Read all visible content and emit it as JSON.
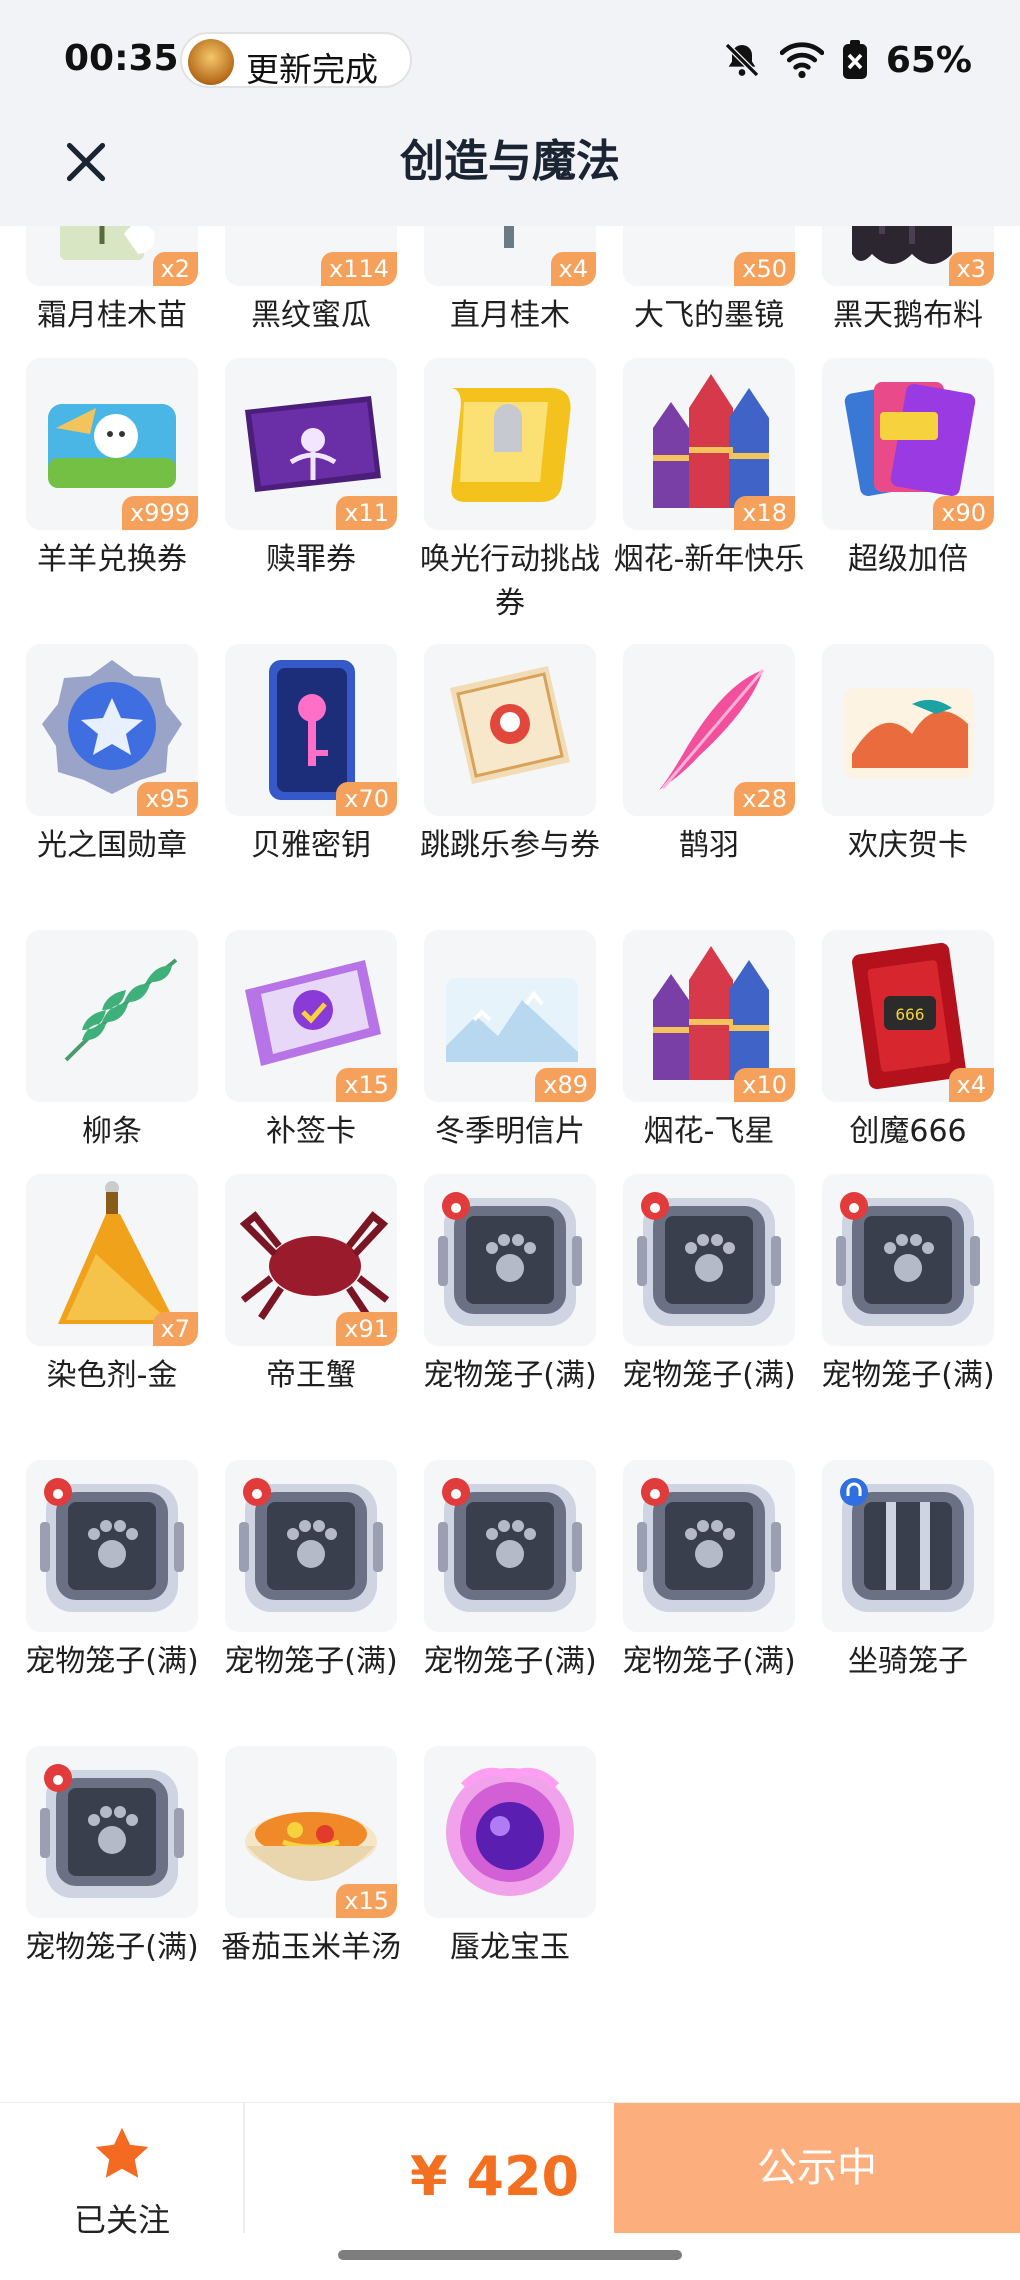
{
  "status": {
    "time": "00:35",
    "notification": "更新完成",
    "battery": "65%"
  },
  "header": {
    "title": "创造与魔法"
  },
  "items": [
    {
      "name": "霜月桂木苗",
      "count": "x2",
      "icon": "plant-pot-icon"
    },
    {
      "name": "黑纹蜜瓜",
      "count": "x114",
      "icon": "melon-icon"
    },
    {
      "name": "直月桂木",
      "count": "x4",
      "icon": "yellow-tree-icon"
    },
    {
      "name": "大飞的墨镜",
      "count": "x50",
      "icon": "sunglasses-icon"
    },
    {
      "name": "黑天鹅布料",
      "count": "x3",
      "icon": "black-cloth-icon"
    },
    {
      "name": "羊羊兑换券",
      "count": "x999",
      "icon": "sheep-ticket-icon"
    },
    {
      "name": "赎罪券",
      "count": "x11",
      "icon": "purple-ticket-icon"
    },
    {
      "name": "唤光行动挑战券",
      "count": "",
      "icon": "yellow-scroll-icon"
    },
    {
      "name": "烟花-新年快乐",
      "count": "x18",
      "icon": "firework-icon"
    },
    {
      "name": "超级加倍",
      "count": "x90",
      "icon": "cards-icon"
    },
    {
      "name": "光之国勋章",
      "count": "x95",
      "icon": "star-medal-icon"
    },
    {
      "name": "贝雅密钥",
      "count": "x70",
      "icon": "key-card-icon"
    },
    {
      "name": "跳跳乐参与券",
      "count": "",
      "icon": "ticket-icon"
    },
    {
      "name": "鹊羽",
      "count": "x28",
      "icon": "pink-feather-icon"
    },
    {
      "name": "欢庆贺卡",
      "count": "",
      "icon": "greeting-card-icon"
    },
    {
      "name": "柳条",
      "count": "",
      "icon": "willow-icon"
    },
    {
      "name": "补签卡",
      "count": "x15",
      "icon": "sign-card-icon"
    },
    {
      "name": "冬季明信片",
      "count": "x89",
      "icon": "postcard-icon"
    },
    {
      "name": "烟花-飞星",
      "count": "x10",
      "icon": "firework-icon"
    },
    {
      "name": "创魔666",
      "count": "x4",
      "icon": "red-card-icon"
    },
    {
      "name": "染色剂-金",
      "count": "x7",
      "icon": "dye-bottle-icon"
    },
    {
      "name": "帝王蟹",
      "count": "x91",
      "icon": "crab-icon"
    },
    {
      "name": "宠物笼子(满)",
      "count": "",
      "icon": "pet-cage-icon"
    },
    {
      "name": "宠物笼子(满)",
      "count": "",
      "icon": "pet-cage-icon"
    },
    {
      "name": "宠物笼子(满)",
      "count": "",
      "icon": "pet-cage-icon"
    },
    {
      "name": "宠物笼子(满)",
      "count": "",
      "icon": "pet-cage-icon"
    },
    {
      "name": "宠物笼子(满)",
      "count": "",
      "icon": "pet-cage-icon"
    },
    {
      "name": "宠物笼子(满)",
      "count": "",
      "icon": "pet-cage-icon"
    },
    {
      "name": "宠物笼子(满)",
      "count": "",
      "icon": "pet-cage-icon"
    },
    {
      "name": "坐骑笼子",
      "count": "",
      "icon": "mount-cage-icon"
    },
    {
      "name": "宠物笼子(满)",
      "count": "",
      "icon": "pet-cage-icon"
    },
    {
      "name": "番茄玉米羊汤",
      "count": "x15",
      "icon": "soup-bowl-icon"
    },
    {
      "name": "蜃龙宝玉",
      "count": "",
      "icon": "dragon-orb-icon"
    }
  ],
  "bottom": {
    "follow_label": "已关注",
    "price": "¥ 420",
    "cta_label": "公示中"
  },
  "colors": {
    "accent": "#f37021",
    "badge": "#f5a15c",
    "cta_bg": "#fdae7d"
  }
}
